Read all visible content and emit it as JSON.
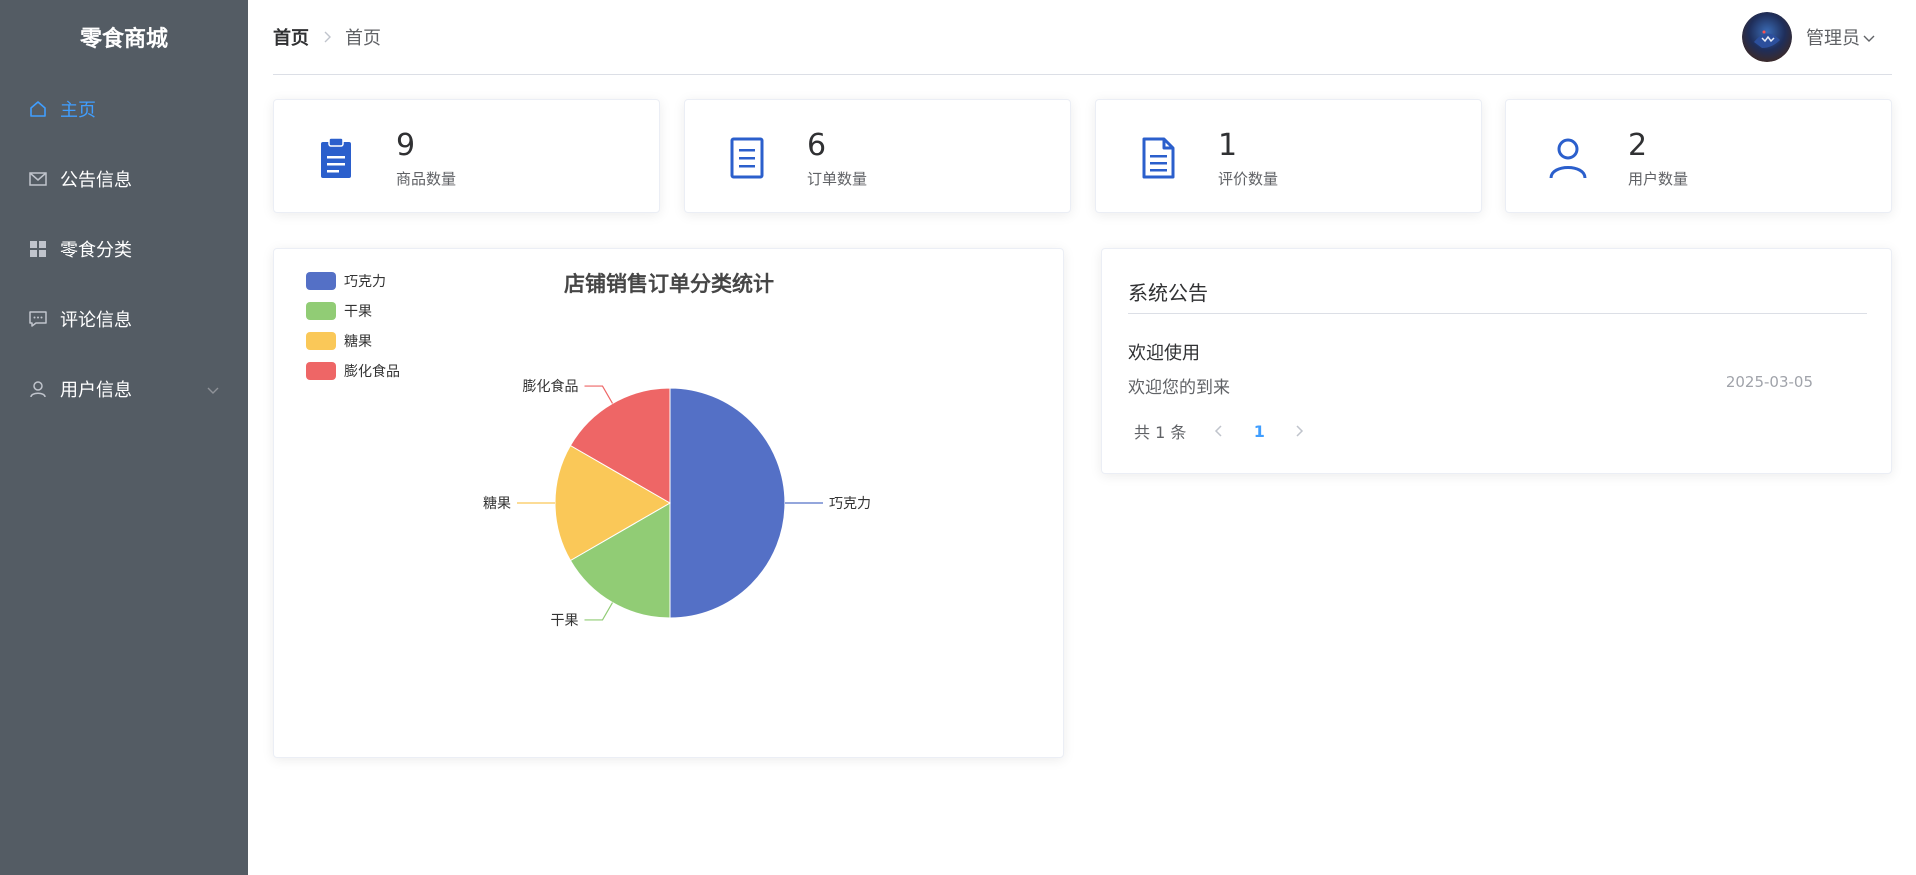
{
  "app": {
    "brand": "零食商城"
  },
  "sidebar": {
    "items": [
      {
        "label": "主页",
        "icon": "home-icon",
        "active": true
      },
      {
        "label": "公告信息",
        "icon": "mail-icon",
        "active": false
      },
      {
        "label": "零食分类",
        "icon": "grid-icon",
        "active": false
      },
      {
        "label": "评论信息",
        "icon": "chat-icon",
        "active": false
      },
      {
        "label": "用户信息",
        "icon": "user-icon",
        "active": false,
        "expandable": true
      }
    ]
  },
  "header": {
    "breadcrumb": [
      "首页",
      "首页"
    ],
    "user": {
      "name": "管理员"
    }
  },
  "stats": [
    {
      "value": "9",
      "label": "商品数量",
      "icon": "clipboard-icon"
    },
    {
      "value": "6",
      "label": "订单数量",
      "icon": "document-icon"
    },
    {
      "value": "1",
      "label": "评价数量",
      "icon": "file-text-icon"
    },
    {
      "value": "2",
      "label": "用户数量",
      "icon": "user-icon"
    }
  ],
  "notice": {
    "title": "系统公告",
    "items": [
      {
        "title": "欢迎使用",
        "body": "欢迎您的到来",
        "date": "2025-03-05"
      }
    ],
    "pager": {
      "total_text": "共 1 条",
      "current": "1"
    }
  },
  "colors": {
    "accent": "#409eff",
    "sidebar_bg": "#545c64",
    "icon_blue": "#2b5fcc"
  },
  "chart_data": {
    "type": "pie",
    "title": "店铺销售订单分类统计",
    "legend_position": "top-left",
    "slices": [
      {
        "name": "巧克力",
        "value": 3,
        "color": "#5470c6"
      },
      {
        "name": "干果",
        "value": 1,
        "color": "#91cc75"
      },
      {
        "name": "糖果",
        "value": 1,
        "color": "#fac858"
      },
      {
        "name": "膨化食品",
        "value": 1,
        "color": "#ee6666"
      }
    ]
  }
}
